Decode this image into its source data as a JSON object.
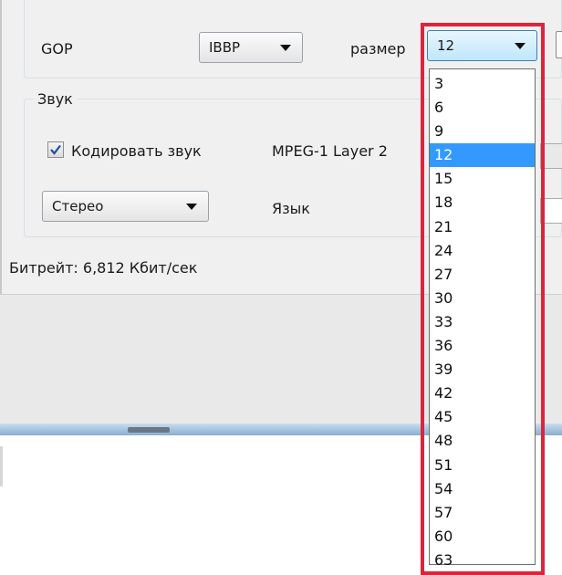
{
  "video": {
    "gop_label": "GOP",
    "gop_value": "IBBP",
    "size_label": "размер",
    "size_value": "12"
  },
  "audio": {
    "group_label": "Звук",
    "encode_label": "Кодировать звук",
    "encode_checked": true,
    "codec": "MPEG-1 Layer 2",
    "channels_value": "Стерео",
    "language_label": "Язык"
  },
  "bitrate_text": "Битрейт: 6,812 Кбит/сек",
  "size_dropdown": {
    "selected": "12",
    "options": [
      "3",
      "6",
      "9",
      "12",
      "15",
      "18",
      "21",
      "24",
      "27",
      "30",
      "33",
      "36",
      "39",
      "42",
      "45",
      "48",
      "51",
      "54",
      "57",
      "60",
      "63"
    ]
  },
  "colors": {
    "highlight_frame": "#d9263b",
    "selection": "#3399ff"
  },
  "icons": {
    "combo_arrow": "chevron-down-icon",
    "checkbox_mark": "checkmark-icon"
  }
}
